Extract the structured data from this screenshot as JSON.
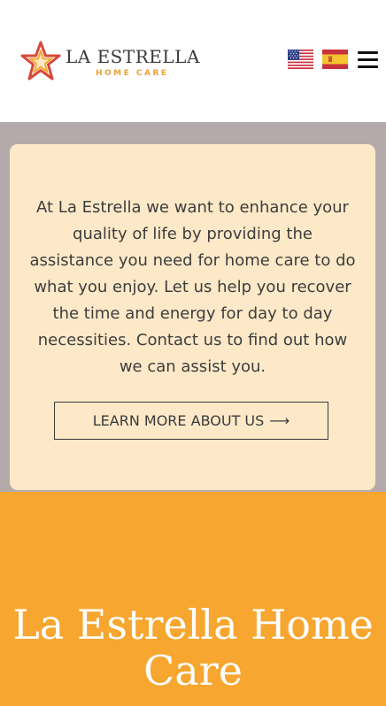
{
  "header": {
    "brand_name": "LA ESTRELLA",
    "brand_subtitle": "HOME CARE",
    "languages": [
      {
        "code": "en",
        "icon": "us-flag-icon"
      },
      {
        "code": "es",
        "icon": "spain-flag-icon"
      }
    ],
    "menu_icon": "hamburger-menu-icon"
  },
  "intro": {
    "text": "At La Estrella we want to enhance your quality of life by providing the assistance you need for home care to do what you enjoy. Let us help you recover the time and energy for day to day necessities. Contact us to find out how we can assist you.",
    "button_label": "LEARN MORE ABOUT US",
    "button_arrow": "⟶"
  },
  "hero": {
    "title": "La Estrella Home Care"
  },
  "colors": {
    "brand_orange": "#f7a630",
    "brand_red": "#d6483a",
    "card_background": "#fde9c8",
    "band_background": "#b5aaab",
    "text_dark": "#3d3d3d"
  }
}
